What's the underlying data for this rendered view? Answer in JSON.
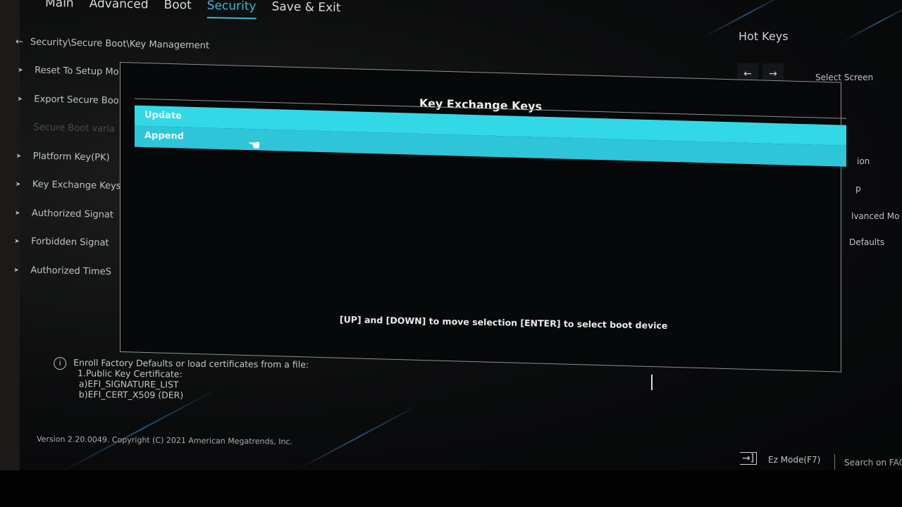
{
  "tabs": [
    {
      "label": "Main"
    },
    {
      "label": "Advanced"
    },
    {
      "label": "Boot"
    },
    {
      "label": "Security",
      "active": true
    },
    {
      "label": "Save & Exit"
    }
  ],
  "breadcrumb": {
    "icon": "back-arrow-icon",
    "text": "Security\\Secure Boot\\Key Management"
  },
  "menu": [
    {
      "label": "Reset To Setup Mo",
      "disabled": false
    },
    {
      "label": "Export Secure Boo",
      "disabled": false
    },
    {
      "label": "Secure Boot varia",
      "disabled": true
    },
    {
      "label": "Platform Key(PK)",
      "disabled": false
    },
    {
      "label": "Key Exchange Keys",
      "disabled": false
    },
    {
      "label": "Authorized Signat",
      "disabled": false
    },
    {
      "label": "Forbidden  Signat",
      "disabled": false
    },
    {
      "label": "Authorized TimeS",
      "disabled": false
    }
  ],
  "hotkeys": {
    "title": "Hot Keys",
    "left": "←",
    "right": "→",
    "select_screen": "Select Screen",
    "partials": [
      "ion",
      "p",
      "lvanced Mo",
      "Defaults"
    ]
  },
  "dialog": {
    "title": "Key Exchange Keys",
    "options": [
      "Update",
      "Append"
    ],
    "hint": "[UP] and [DOWN] to move selection  [ENTER] to select boot device"
  },
  "info": {
    "lines": [
      "Enroll Factory Defaults or load certificates from a file:",
      "1.Public Key Certificate:",
      "a)EFI_SIGNATURE_LIST",
      "b)EFI_CERT_X509 (DER)"
    ]
  },
  "footer": {
    "version": "Version 2.20.0049. Copyright (C) 2021 American Megatrends, Inc.",
    "ez_mode": "Ez Mode(F7)",
    "search": "Search on FAC"
  },
  "colors": {
    "accent": "#3fb7d6",
    "highlight": "#33d8e6"
  }
}
